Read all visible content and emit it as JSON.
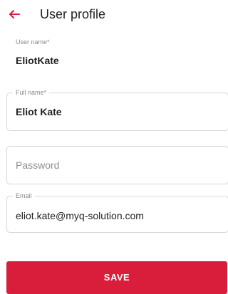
{
  "header": {
    "title": "User profile",
    "back_icon": "arrow-left-icon",
    "accent_color": "#d81e3a"
  },
  "form": {
    "username": {
      "label": "User name*",
      "value": "EliotKate"
    },
    "fullname": {
      "label": "Full name*",
      "value": "Eliot Kate"
    },
    "password": {
      "placeholder": "Password"
    },
    "email": {
      "label": "Email",
      "value": "eliot.kate@myq-solution.com"
    }
  },
  "actions": {
    "save_label": "SAVE",
    "save_color": "#d81e3a"
  }
}
